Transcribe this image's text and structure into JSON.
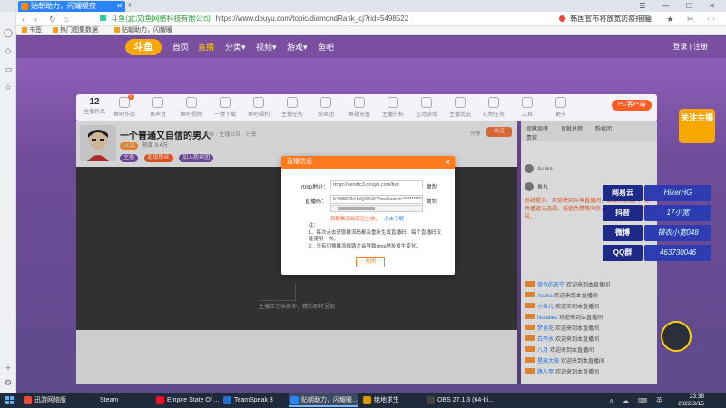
{
  "browser": {
    "tab_title": "贴朝助力，闪耀暖夜",
    "new_tab_glyph": "+",
    "window_controls": "☰ — ☐ ✕",
    "back": "‹",
    "forward": "›",
    "refresh": "↻",
    "home": "⌂",
    "url_org": "斗鱼(武汉)鱼网络科技有限公司",
    "url": "https://www.douyu.com/topic/diamondRank_cj?rid=5498522",
    "right_news": "韩国宣布将放宽防疫措施",
    "tools": "⊕ ★ ✂ ⋯",
    "bookmarks": [
      "书签",
      "热门图集数据",
      "贴朝助力，闪耀暖"
    ]
  },
  "site": {
    "logo": "斗鱼",
    "nav": [
      "首页",
      "直播",
      "分类▾",
      "视频▾",
      "游戏▾",
      "鱼吧"
    ],
    "active_nav": "直播",
    "header_right": "登录 | 注册"
  },
  "category_strip": {
    "count": "12",
    "count_label": "主播作品",
    "items": [
      {
        "label": "鱼吧作品",
        "badge": "9"
      },
      {
        "label": "鱼声音"
      },
      {
        "label": "鱼吧视频"
      },
      {
        "label": "一键下载"
      },
      {
        "label": "鱼吧福利"
      },
      {
        "label": "主播任务"
      },
      {
        "label": "粉丝团"
      },
      {
        "label": "鱼翅充值"
      },
      {
        "label": "主播分析"
      },
      {
        "label": "互动游戏"
      },
      {
        "label": "主播优选"
      },
      {
        "label": "礼物任务"
      },
      {
        "label": "工具"
      },
      {
        "label": "更多"
      }
    ],
    "pc_button": "PC客户端"
  },
  "room": {
    "title": "一个普通又自信的男人",
    "meta": "举报 · 主播公告 · 分享",
    "level": "Lv.21",
    "hot": "热度 9.4万",
    "tags": [
      "主播",
      "超级粉丝",
      "加入粉丝团"
    ],
    "follow": "关注",
    "report": "分享"
  },
  "video": {
    "status_text": "主播正在休息中，精彩即将呈现"
  },
  "chat": {
    "tabs": [
      "贡献周榜",
      "贡献总榜",
      "粉丝团",
      "贵宾"
    ],
    "ranks": [
      "Asuka",
      "鱼丸",
      "三九"
    ],
    "notice": "系统提示：欢迎来到斗鱼直播间，请文明观看，严禁传播违法违规、低俗色情等内容，若有违反将封停账号。",
    "messages": [
      {
        "name": "蓝色的天空",
        "text": "欢迎来到本直播间"
      },
      {
        "name": "Asuka",
        "text": "欢迎来到本直播间"
      },
      {
        "name": "小鱼儿",
        "text": "欢迎来到本直播间"
      },
      {
        "name": "Noodles",
        "text": "欢迎来到本直播间"
      },
      {
        "name": "梦里花",
        "text": "欢迎来到本直播间"
      },
      {
        "name": "白开水",
        "text": "欢迎来到本直播间"
      },
      {
        "name": "八月",
        "text": "欢迎来到本直播间"
      },
      {
        "name": "星辰大海",
        "text": "欢迎来到本直播间"
      },
      {
        "name": "路人甲",
        "text": "欢迎来到本直播间"
      }
    ]
  },
  "modal": {
    "title": "直播信息",
    "rtmp_label": "rtmp地址：",
    "rtmp_value": "rtmp://sendtc3.douyu.com/live",
    "code_label": "直播码：",
    "code_value": "5498522rHxQ2BOP?wsSecret=**********",
    "copy": "复制",
    "code_hint": "获取推流码后已生效，",
    "code_hint_action": "点击了解",
    "notes_title": "注：",
    "note1": "1、每次点击获取推流码都会重新生成直播码，每个直播码仅能使用一次。",
    "note2": "2、只有切换推流线路才会导致rtmp地址发生变化。",
    "close_button": "关闭"
  },
  "poster": {
    "title": "关注主播",
    "social": [
      {
        "name": "网易云",
        "value": "HikerHG"
      },
      {
        "name": "抖音",
        "value": "17小宽"
      },
      {
        "name": "微博",
        "value": "锦衣小宽048"
      },
      {
        "name": "QQ群",
        "value": "463730046"
      }
    ]
  },
  "taskbar": {
    "items": [
      {
        "label": "迅游网络版",
        "color": "#e84c3d"
      },
      {
        "label": "Steam",
        "color": "#1b2838"
      },
      {
        "label": "Empire State Of ...",
        "color": "#e8142a"
      },
      {
        "label": "TeamSpeak 3",
        "color": "#2a6fc9"
      },
      {
        "label": "贴朝助力，闪耀暖...",
        "color": "#2a83ff"
      },
      {
        "label": "绝地求生",
        "color": "#d49a00"
      },
      {
        "label": "OBS 27.1.3 (64-bi...",
        "color": "#444"
      }
    ],
    "tray": "∧ ☁ ⌨ 英",
    "time": "23:38",
    "date": "2022/3/15"
  }
}
